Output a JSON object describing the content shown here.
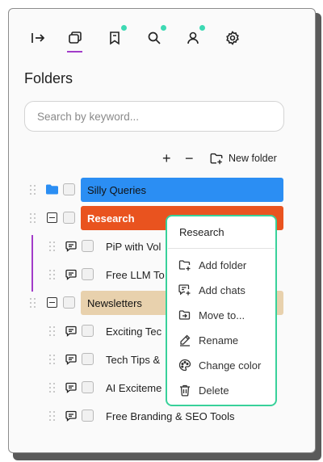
{
  "icons": {
    "nav": [
      "collapse-sidebar-icon",
      "folders-icon",
      "bookmark-icon",
      "search-icon",
      "user-icon",
      "settings-icon"
    ],
    "accent_color": "#a23cc9",
    "notification_dot_color": "#3dd9b3"
  },
  "folders_title": "Folders",
  "search": {
    "placeholder": "Search by keyword..."
  },
  "toolbar": {
    "expand_label": "+",
    "collapse_label": "−",
    "new_folder_label": "New folder"
  },
  "tree": {
    "silly_queries": {
      "label": "Silly Queries",
      "color": "#2b8ef3"
    },
    "research": {
      "label": "Research",
      "color": "#e9531f",
      "chats": [
        "PiP with Vol",
        "Free LLM To"
      ]
    },
    "newsletters": {
      "label": "Newsletters",
      "color": "#e8d1ad",
      "chats": [
        "Exciting Tec",
        "Tech Tips &",
        "AI Exciteme",
        "Free Branding & SEO Tools"
      ]
    }
  },
  "context_menu": {
    "title": "Research",
    "items": [
      "Add folder",
      "Add chats",
      "Move to...",
      "Rename",
      "Change color",
      "Delete"
    ],
    "border_color": "#38d19a"
  }
}
